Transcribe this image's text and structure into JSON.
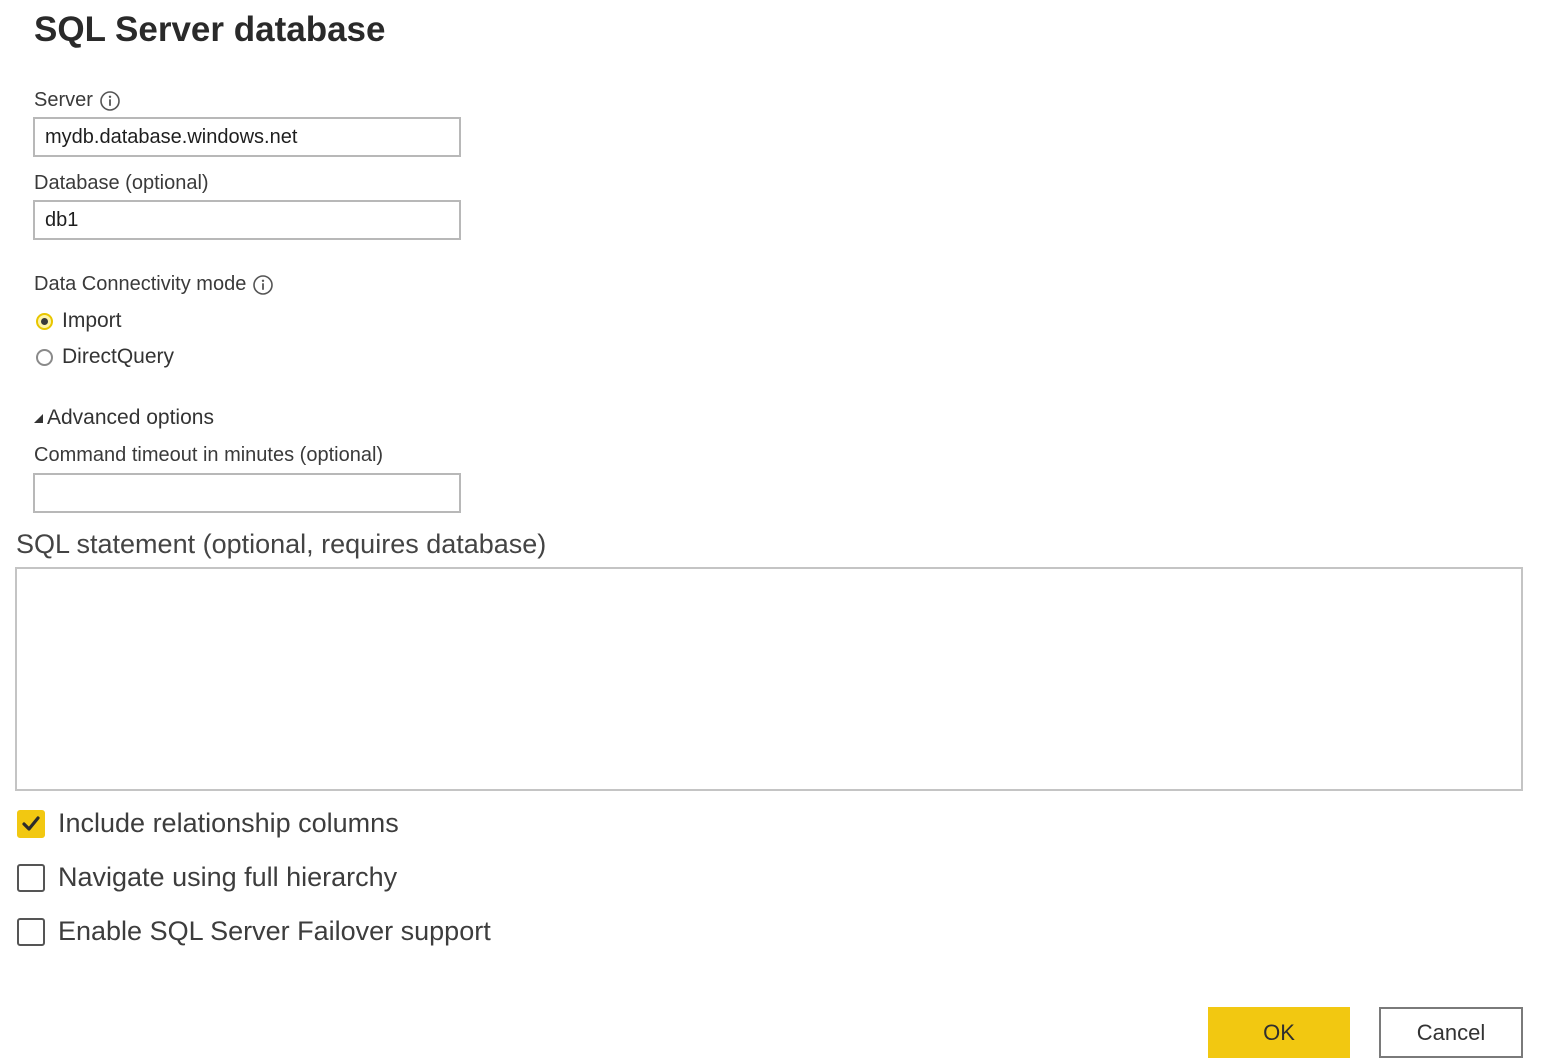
{
  "dialog": {
    "title": "SQL Server database"
  },
  "server": {
    "label": "Server",
    "value": "mydb.database.windows.net"
  },
  "database": {
    "label": "Database (optional)",
    "value": "db1"
  },
  "connectivity": {
    "label": "Data Connectivity mode",
    "options": [
      {
        "label": "Import",
        "selected": true
      },
      {
        "label": "DirectQuery",
        "selected": false
      }
    ]
  },
  "advanced": {
    "toggle_label": "Advanced options",
    "timeout_label": "Command timeout in minutes (optional)",
    "timeout_value": "",
    "sql_label": "SQL statement (optional, requires database)",
    "sql_value": "",
    "checkboxes": [
      {
        "label": "Include relationship columns",
        "checked": true
      },
      {
        "label": "Navigate using full hierarchy",
        "checked": false
      },
      {
        "label": "Enable SQL Server Failover support",
        "checked": false
      }
    ]
  },
  "buttons": {
    "ok_label": "OK",
    "cancel_label": "Cancel"
  },
  "colors": {
    "accent": "#f2c811",
    "input_border": "#b8b8b8",
    "text": "#252525"
  },
  "icons": {
    "info": "info-icon",
    "expander": "triangle-expanded-icon",
    "checkmark": "checkmark-icon"
  }
}
